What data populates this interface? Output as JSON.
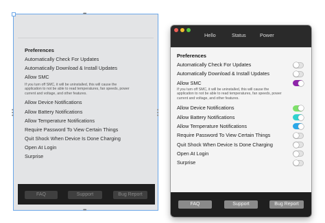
{
  "designer": {
    "preferences_title": "Preferences",
    "items": [
      "Automatically Check For Updates",
      "Automatically Download & Install Updates",
      "Allow SMC",
      "Allow Device Notifications",
      "Allow Battery Notifications",
      "Allow Temperature Notifications",
      "Require Password To View Certain Things",
      "Quit Shock When Device Is Done Charging",
      "Open At Login",
      "Surprise"
    ],
    "smc_note": "If you turn off SMC, it will be uninstalled, this will cause the application to not be able to read temperatures, fan speeds, power current and voltage, and other features.",
    "buttons": {
      "faq": "FAQ",
      "support": "Support",
      "bug_report": "Bug Report"
    }
  },
  "app": {
    "tabs": {
      "hello": "Hello",
      "status": "Status",
      "power": "Power"
    },
    "preferences_title": "Preferences",
    "items": [
      {
        "label": "Automatically Check For Updates",
        "on": false,
        "color": ""
      },
      {
        "label": "Automatically Download & Install Updates",
        "on": false,
        "color": ""
      },
      {
        "label": "Allow SMC",
        "on": true,
        "color": "#8e24aa"
      },
      {
        "label": "Allow Device Notifications",
        "on": true,
        "color": "#7ee06a"
      },
      {
        "label": "Allow Battery Notifications",
        "on": true,
        "color": "#2fd2cf"
      },
      {
        "label": "Allow Temperature Notifications",
        "on": true,
        "color": "#2aa8e8"
      },
      {
        "label": "Require Password To View Certain Things",
        "on": false,
        "color": ""
      },
      {
        "label": "Quit Shock When Device Is Done Charging",
        "on": false,
        "color": ""
      },
      {
        "label": "Open At Login",
        "on": false,
        "color": ""
      },
      {
        "label": "Surprise",
        "on": false,
        "color": ""
      }
    ],
    "smc_note": "If you turn off SMC, it will be uninstalled, this will cause the application to not be able to read temperatures, fan speeds, power current and voltage, and other features.",
    "buttons": {
      "faq": "FAQ",
      "support": "Support",
      "bug_report": "Bug Report"
    },
    "traffic_lights": {
      "close": "#ec5f57",
      "minimize": "#f2be2e",
      "zoom": "#58c840"
    }
  }
}
